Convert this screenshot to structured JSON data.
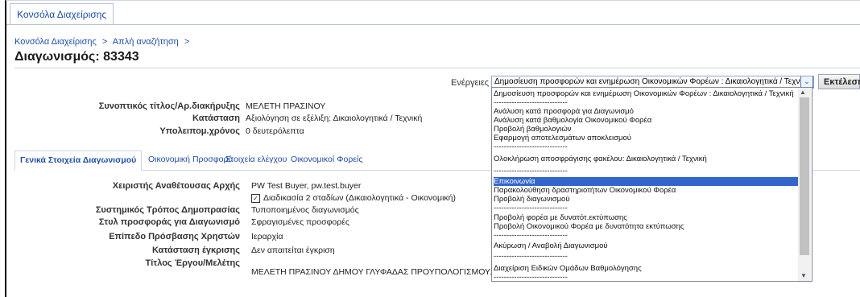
{
  "app": {
    "top_tab": "Κονσόλα Διαχείρισης"
  },
  "breadcrumb": {
    "item1": "Κονσόλα Διαχείρισης",
    "sep1": ">",
    "item2": "Απλή αναζήτηση",
    "sep2": ">"
  },
  "page": {
    "title": "Διαγωνισμός: 83343"
  },
  "actions": {
    "label": "Ενέργειες",
    "selected": "Δημοσίευση προσφορών και ενημέρωση Οικονομικών Φορέων : Δικαιολογητικά / Τεχνική",
    "execute_label": "Εκτέλεση",
    "options": [
      "Δημοσίευση προσφορών και ενημέρωση Οικονομικών Φορέων : Δικαιολογητικά / Τεχνική",
      "-----------------------------",
      "Ανάλυση κατά προσφορά για Διαγωνισμό",
      "Ανάλυση κατά βαθμολογία Οικονομικού Φορέα",
      "Προβολή βαθμολογιών",
      "Εφαρμογή αποτελεσμάτων αποκλεισμού",
      "-----------------------------",
      "Ολοκλήρωση αποσφράγισης φακέλου: Δικαιολογητικά / Τεχνική",
      "-----------------------------",
      "Επικοινωνία",
      "Παρακολούθηση δραστηριοτήτων Οικονομικού Φορέα",
      "Προβολή διαγωνισμού",
      "-----------------------------",
      "Προβολή φορέα με δυνατότ.εκτύπωσης",
      "Προβολή Οικονομικού Φορέα με δυνατότητα εκτύπωσης",
      "-----------------------------",
      "Ακύρωση / Αναβολή Διαγωνισμού",
      "-----------------------------",
      "Διαχείριση Ειδικών Ομάδων Βαθμολόγησης",
      "-----------------------------"
    ],
    "highlighted_option": "Επικοινωνία"
  },
  "summary": {
    "title_label": "Συνοπτικός τίτλος/Αρ.διακήρυξης",
    "title_value": "ΜΕΛΕΤΗ ΠΡΑΣΙΝΟΥ",
    "status_label": "Κατάσταση",
    "status_value": "Αξιολόγηση σε εξέλιξη: Δικαιολογητικά / Τεχνική",
    "remaining_label": "Υπολειπομ.χρόνος",
    "remaining_value": "0 δευτερόλεπτα"
  },
  "tabs": {
    "general": "Γενικά Στοιχεία Διαγωνισμού",
    "financial": "Οικονομική Προσφορά",
    "control": "Στοιχεία ελέγχου",
    "vendors": "Οικονομικοί Φορείς"
  },
  "details": {
    "manager_label": "Χειριστής Αναθέτουσας Αρχής",
    "manager_value": "PW Test Buyer, pw.test.buyer",
    "two_stage_label": "Διαδικασία 2 σταδίων (Δικαιολογητικά - Οικονομική)",
    "publish_method_label": "Συστημικός Τρόπος Δημοπρασίας",
    "publish_method_value": "Τυποποιημένος διαγωνισμός",
    "offer_style_label": "Στυλ προσφοράς για Διαγωνισμό",
    "offer_style_value": "Σφραγισμένες προσφορές",
    "access_label": "Επίπεδο Πρόσβασης Χρηστών",
    "access_value": "Ιεραρχία",
    "approval_label": "Κατάσταση έγκρισης",
    "approval_value": "Δεν απαιτείται έγκριση",
    "project_label": "Τίτλος Έργου/Μελέτης",
    "project_value": "ΜΕΛΕΤΗ ΠΡΑΣΙΝΟΥ ΔΗΜΟΥ ΓΛΥΦΑΔΑΣ ΠΡΟΥΠΟΛΟΓΙΣΜΟΥ..."
  }
}
